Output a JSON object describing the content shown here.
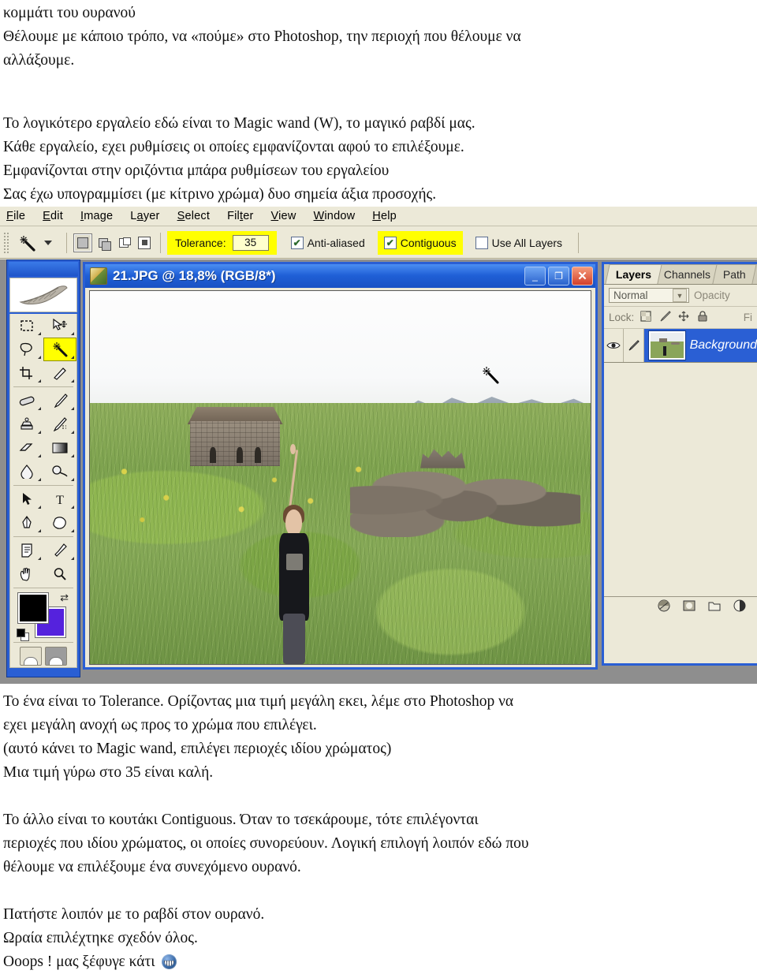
{
  "document": {
    "top_paragraphs": [
      "κομμάτι του ουρανού",
      "Θέλουμε με κάποιο τρόπο, να «πούμε» στο Photoshop, την περιοχή που θέλουμε να",
      "αλλάξουμε."
    ],
    "intro_paragraphs": [
      "Το λογικότερο εργαλείο εδώ είναι το Magic wand (W), το μαγικό ραβδί μας.",
      "Κάθε εργαλείο, εχει ρυθμίσεις οι οποίες εμφανίζονται αφού το επιλέξουμε.",
      "Εμφανίζονται στην οριζόντια μπάρα ρυθμίσεων του εργαλείου",
      "Σας έχω υπογραμμίσει (με κίτρινο χρώμα) δυο σημεία άξια προσοχής."
    ],
    "tolerance_paragraphs": [
      "Το ένα είναι το Tolerance. Ορίζοντας μια τιμή μεγάλη εκει, λέμε στο Photoshop να",
      "εχει μεγάλη ανοχή ως προς το χρώμα που επιλέγει.",
      "(αυτό κάνει το Magic wand, επιλέγει περιοχές ιδίου χρώματος)",
      "Μια τιμή γύρω στο 35 είναι καλή."
    ],
    "contiguous_paragraphs": [
      "Το άλλο είναι το κουτάκι Contiguous. Όταν το τσεκάρουμε, τότε επιλέγονται",
      "περιοχές που ιδίου χρώματος, οι οποίες συνορεύουν. Λογική επιλογή λοιπόν εδώ που",
      "θέλουμε να επιλέξουμε ένα συνεχόμενο ουρανό."
    ],
    "closing_paragraphs": [
      "Πατήστε λοιπόν με το ραβδί στον ουρανό.",
      "Ωραία επιλέχτηκε σχεδόν όλος.",
      "Οοops ! μας ξέφυγε κάτι"
    ]
  },
  "photoshop": {
    "menubar": [
      {
        "label": "File",
        "accel": "F",
        "rest": "ile"
      },
      {
        "label": "Edit",
        "accel": "E",
        "rest": "dit"
      },
      {
        "label": "Image",
        "accel": "I",
        "rest": "mage"
      },
      {
        "label": "Layer",
        "accel": "L",
        "rest": "ayer"
      },
      {
        "label": "Select",
        "accel": "S",
        "rest": "elect"
      },
      {
        "label": "Filter",
        "accel": "t",
        "rest": "Filter"
      },
      {
        "label": "View",
        "accel": "V",
        "rest": "iew"
      },
      {
        "label": "Window",
        "accel": "W",
        "rest": "indow"
      },
      {
        "label": "Help",
        "accel": "H",
        "rest": "elp"
      }
    ],
    "options_bar": {
      "active_tool_icon": "magic-wand-icon",
      "selection_modes": [
        "new-selection",
        "add-to-selection",
        "subtract-from-selection",
        "intersect-with-selection"
      ],
      "tolerance_label": "Tolerance:",
      "tolerance_value": "35",
      "tolerance_highlighted": true,
      "anti_aliased_label": "Anti-aliased",
      "anti_aliased_checked": true,
      "contiguous_label": "Contiguous",
      "contiguous_checked": true,
      "contiguous_highlighted": true,
      "use_all_layers_label": "Use All Layers",
      "use_all_layers_checked": false,
      "highlight_color": "#ffff00"
    },
    "toolbox": {
      "selected_tool": "magic-wand-tool",
      "tools": [
        [
          "rectangular-marquee-tool",
          "move-tool"
        ],
        [
          "lasso-tool",
          "magic-wand-tool"
        ],
        [
          "crop-tool",
          "slice-tool"
        ],
        [
          "healing-brush-tool",
          "brush-tool"
        ],
        [
          "clone-stamp-tool",
          "history-brush-tool"
        ],
        [
          "eraser-tool",
          "gradient-tool"
        ],
        [
          "blur-tool",
          "dodge-tool"
        ],
        [
          "path-selection-tool",
          "type-tool"
        ],
        [
          "pen-tool",
          "custom-shape-tool"
        ],
        [
          "notes-tool",
          "eyedropper-tool"
        ],
        [
          "hand-tool",
          "zoom-tool"
        ]
      ],
      "foreground_color": "#000000",
      "background_color": "#5522dd"
    },
    "document_window": {
      "title": "21.JPG @ 18,8% (RGB/8*)",
      "zoom": "18,8%",
      "color_mode": "RGB/8*",
      "file_name": "21.JPG",
      "minimize_label": "_",
      "maximize_label": "❐",
      "close_label": "✕",
      "cursor": "magic-wand-cursor"
    },
    "layers_palette": {
      "tabs": [
        "Layers",
        "Channels",
        "Path"
      ],
      "active_tab": "Layers",
      "blend_mode": "Normal",
      "opacity_label": "Opacity",
      "lock_label": "Lock:",
      "lock_icons": [
        "lock-transparent-pixels-icon",
        "lock-image-pixels-icon",
        "lock-position-icon",
        "lock-all-icon"
      ],
      "fill_label": "Fi",
      "layers": [
        {
          "name": "Background",
          "visible": true,
          "locked": true,
          "selected": true
        }
      ],
      "footer_buttons": [
        "layer-style-icon",
        "layer-mask-icon",
        "new-group-icon",
        "adjustment-layer-icon"
      ]
    }
  }
}
